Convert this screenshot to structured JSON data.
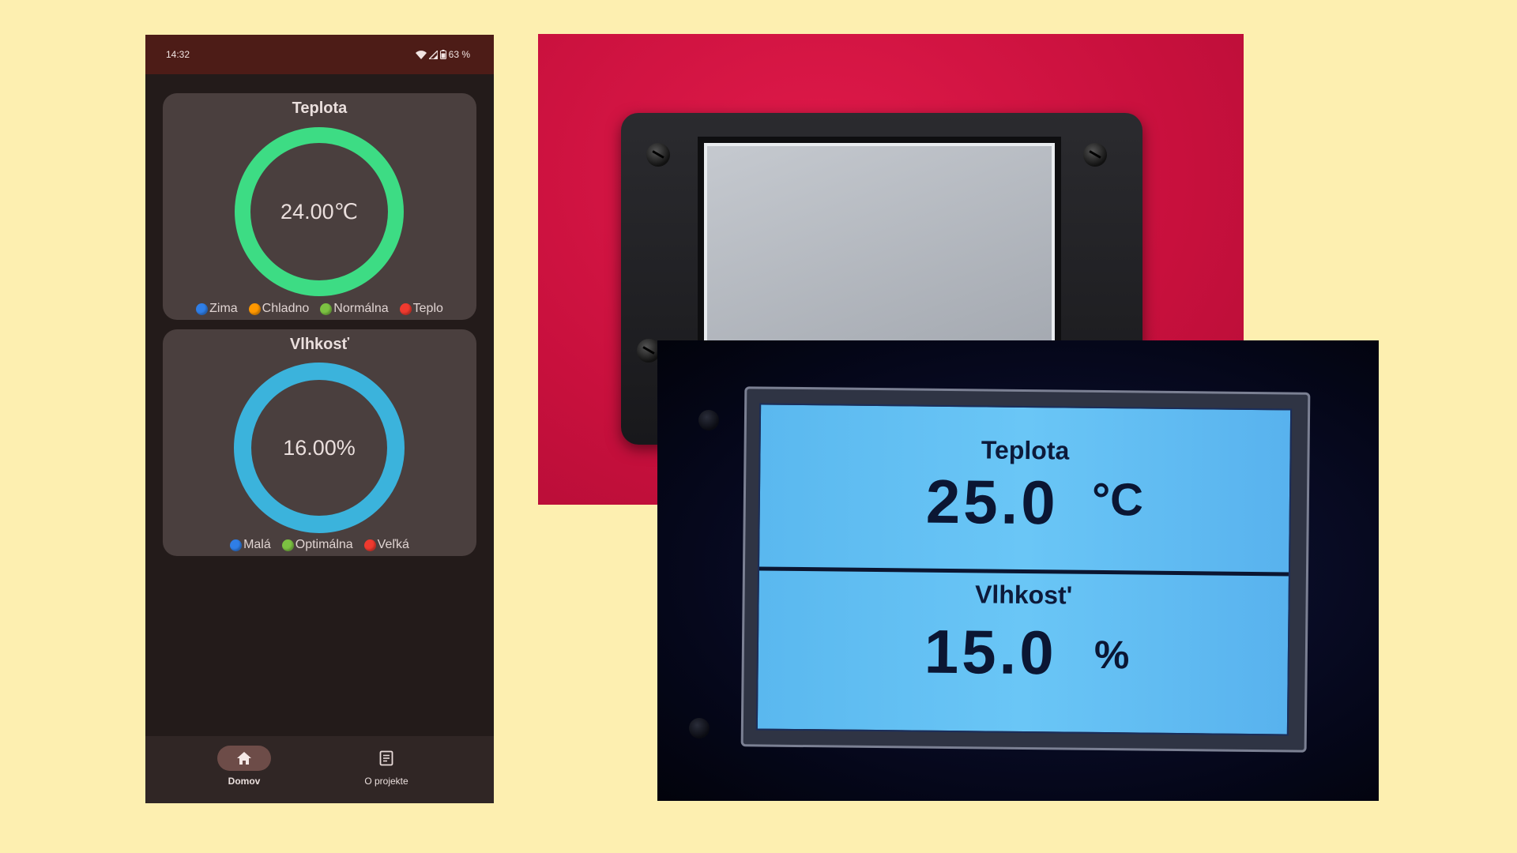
{
  "phone": {
    "status_bar": {
      "time": "14:32",
      "battery": "63 %"
    },
    "temperature_card": {
      "title": "Teplota",
      "value": "24.00℃",
      "gauge_color": "#3ddc84",
      "legend": [
        {
          "label": "Zima",
          "color": "#2f7ee6"
        },
        {
          "label": "Chladno",
          "color": "#ff9800"
        },
        {
          "label": "Normálna",
          "color": "#7cc242"
        },
        {
          "label": "Teplo",
          "color": "#ef3a2f"
        }
      ]
    },
    "humidity_card": {
      "title": "Vlhkosť",
      "value": "16.00%",
      "gauge_color": "#3bb3dc",
      "legend": [
        {
          "label": "Malá",
          "color": "#2f7ee6"
        },
        {
          "label": "Optimálna",
          "color": "#7cc242"
        },
        {
          "label": "Veľká",
          "color": "#ef3a2f"
        }
      ]
    },
    "bottom_nav": {
      "home_label": "Domov",
      "about_label": "O projekte",
      "home_icon": "home-icon",
      "about_icon": "article-icon"
    }
  },
  "lcd_photo": {
    "temperature_label": "Teplota",
    "temperature_value": "25.0",
    "temperature_unit": "°C",
    "humidity_label": "Vlhkost'",
    "humidity_value": "15.0",
    "humidity_unit": "%"
  }
}
